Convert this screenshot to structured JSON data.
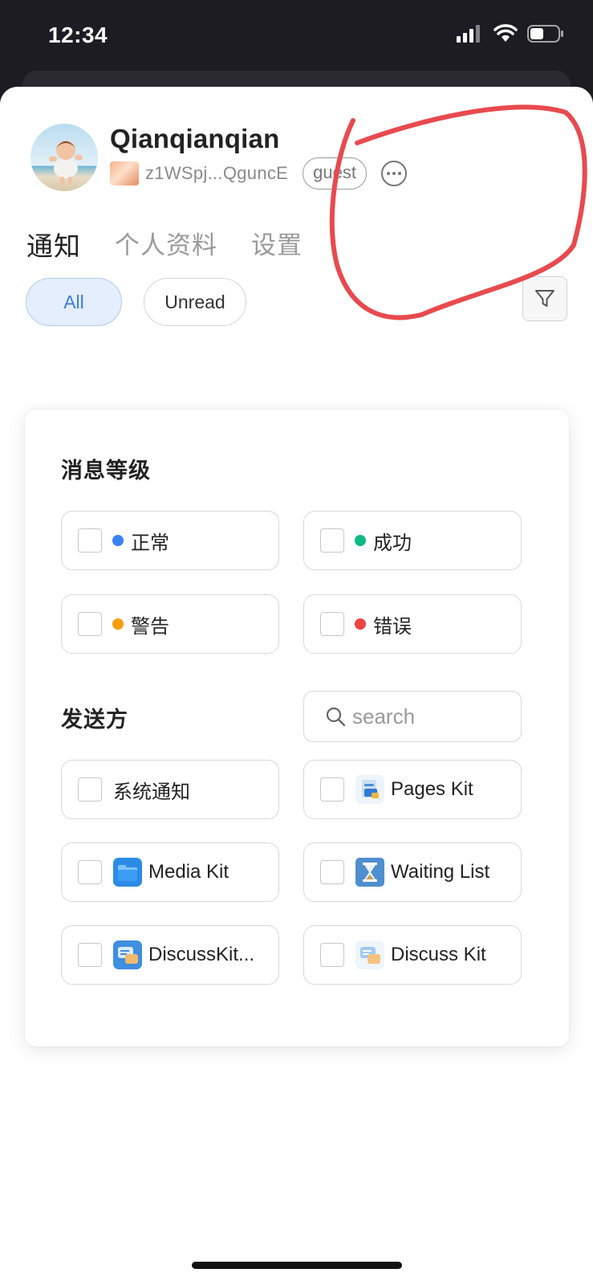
{
  "status_bar": {
    "time": "12:34"
  },
  "profile": {
    "name": "Qianqianqian",
    "address": "z1WSpj...QguncE",
    "role_badge": "guest"
  },
  "tabs": [
    {
      "label": "通知",
      "active": true
    },
    {
      "label": "个人资料",
      "active": false
    },
    {
      "label": "设置",
      "active": false
    }
  ],
  "filter_pills": {
    "all": "All",
    "unread": "Unread"
  },
  "filter_panel": {
    "level_title": "消息等级",
    "levels": [
      {
        "label": "正常",
        "color": "#3b82f6"
      },
      {
        "label": "成功",
        "color": "#10b981"
      },
      {
        "label": "警告",
        "color": "#f59e0b"
      },
      {
        "label": "错误",
        "color": "#ef4444"
      }
    ],
    "sender_title": "发送方",
    "search_placeholder": "search",
    "senders": [
      {
        "label": "系统通知",
        "icon": "none"
      },
      {
        "label": "Pages Kit",
        "icon": "pages-kit-icon"
      },
      {
        "label": "Media Kit",
        "icon": "media-kit-folder-icon"
      },
      {
        "label": "Waiting List",
        "icon": "hourglass-icon"
      },
      {
        "label": "DiscussKit...",
        "icon": "discusskit-chat-icon"
      },
      {
        "label": "Discuss Kit",
        "icon": "discuss-kit-chat-icon"
      }
    ]
  },
  "colors": {
    "accent": "#3d7be0",
    "annotation": "#e84a4f"
  }
}
